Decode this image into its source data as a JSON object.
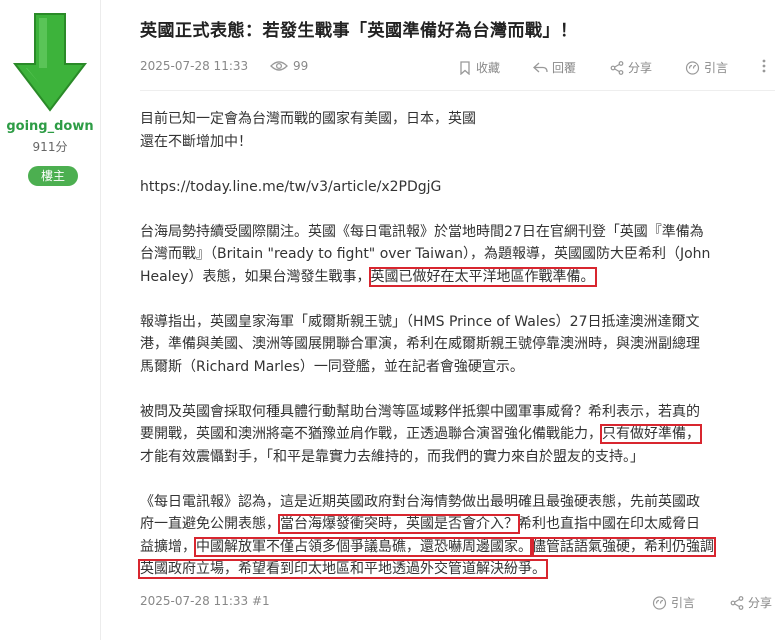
{
  "post": {
    "title": "英國正式表態：若發生戰事「英國準備好為台灣而戰」！",
    "date": "2025-07-28 11:33",
    "views": "99",
    "actions": {
      "bookmark": "收藏",
      "reply": "回覆",
      "share": "分享",
      "quote": "引言"
    }
  },
  "author": {
    "name": "going_down",
    "score": "911分",
    "badge": "樓主",
    "avatar_icon": "green-down-arrow",
    "avatar_color": "#3db33b"
  },
  "content": {
    "p1_l1": "目前已知一定會為台灣而戰的國家有美國，日本，英國",
    "p1_l2": "還在不斷增加中！",
    "link": "https://today.line.me/tw/v3/article/x2PDgjG",
    "p2_l1": "台海局勢持續受國際關注。英國《每日電訊報》於當地時間27日在官網刊登「英國『準備為",
    "p2_l2": "台灣而戰』（Britain \"ready to fight\" over Taiwan），為題報導，英國國防大臣希利（John",
    "p2_l3a": "Healey）表態，如果台灣發生戰事，",
    "p2_l3b": "英國已做好在太平洋地區作戰準備。",
    "p3_l1": "報導指出，英國皇家海軍「威爾斯親王號」（HMS Prince of Wales）27日抵達澳洲達爾文",
    "p3_l2": "港，準備與美國、澳洲等國展開聯合軍演，希利在威爾斯親王號停靠澳洲時，與澳洲副總理",
    "p3_l3": "馬爾斯（Richard Marles）一同登艦，並在記者會強硬宣示。",
    "p4_l1": "被問及英國會採取何種具體行動幫助台灣等區域夥伴抵禦中國軍事威脅？希利表示，若真的",
    "p4_l2a": "要開戰，英國和澳洲將毫不猶豫並肩作戰，正透過聯合演習強化備戰能力，",
    "p4_l2b": "只有做好準備，",
    "p4_l3": "才能有效震懾對手，「和平是靠實力去維持的，而我們的實力來自於盟友的支持。」",
    "p5_l1": "《每日電訊報》認為，這是近期英國政府對台海情勢做出最明確且最強硬表態，先前英國政",
    "p5_l2a": "府一直避免公開表態，",
    "p5_l2b": "當台海爆發衝突時，英國是否會介入？",
    "p5_l2c": "希利也直指中國在印太威脅日",
    "p5_l3a": "益擴增，",
    "p5_l3b": "中國解放軍不僅占領多個爭議島礁，還恐嚇周邊國家。",
    "p5_l3c": "儘管話語氣強硬，希利仍強調",
    "p5_l4": "英國政府立場，希望看到印太地區和平地透過外交管道解決紛爭。"
  },
  "footer": {
    "post_ref": "2025-07-28 11:33 #1",
    "quote": "引言",
    "share": "分享"
  },
  "colors": {
    "highlight_border": "#d8262f",
    "username": "#2d9c45",
    "badge_bg": "#4caf50"
  }
}
